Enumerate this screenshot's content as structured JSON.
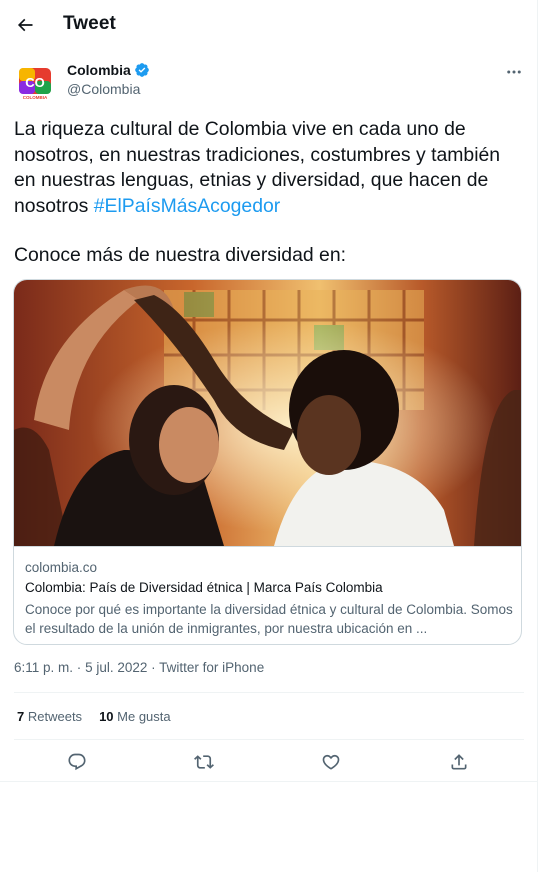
{
  "header": {
    "title": "Tweet",
    "back_icon": "arrow-left-icon"
  },
  "author": {
    "name": "Colombia",
    "handle": "@Colombia",
    "verified": true,
    "avatar_text": "CO",
    "avatar_subtext": "COLOMBIA",
    "avatar_colors": [
      "#e63b2e",
      "#f7b500",
      "#1fa34a",
      "#8a2be2"
    ]
  },
  "tweet": {
    "text_main": "La riqueza cultural de Colombia vive en cada uno de nosotros, en nuestras tradiciones, costumbres y también en nuestras lenguas, etnias y diversidad, que hacen de nosotros ",
    "hashtag": "#ElPaísMásAcogedor",
    "text_second": "Conoce más de nuestra diversidad en:"
  },
  "card": {
    "domain": "colombia.co",
    "title": "Colombia: País de Diversidad étnica | Marca País Colombia",
    "description": "Conoce por qué es importante la diversidad étnica y cultural de Colombia. Somos el resultado de la unión de inmigrantes, por nuestra ubicación en ..."
  },
  "meta": {
    "time": "6:11 p. m.",
    "separator": "·",
    "date": "5 jul. 2022",
    "source": "Twitter for iPhone"
  },
  "stats": {
    "retweets_count": "7",
    "retweets_label": "Retweets",
    "likes_count": "10",
    "likes_label": "Me gusta"
  },
  "colors": {
    "accent": "#1d9bf0",
    "text": "#0f1419",
    "secondary": "#536471",
    "border": "#cfd9de"
  }
}
